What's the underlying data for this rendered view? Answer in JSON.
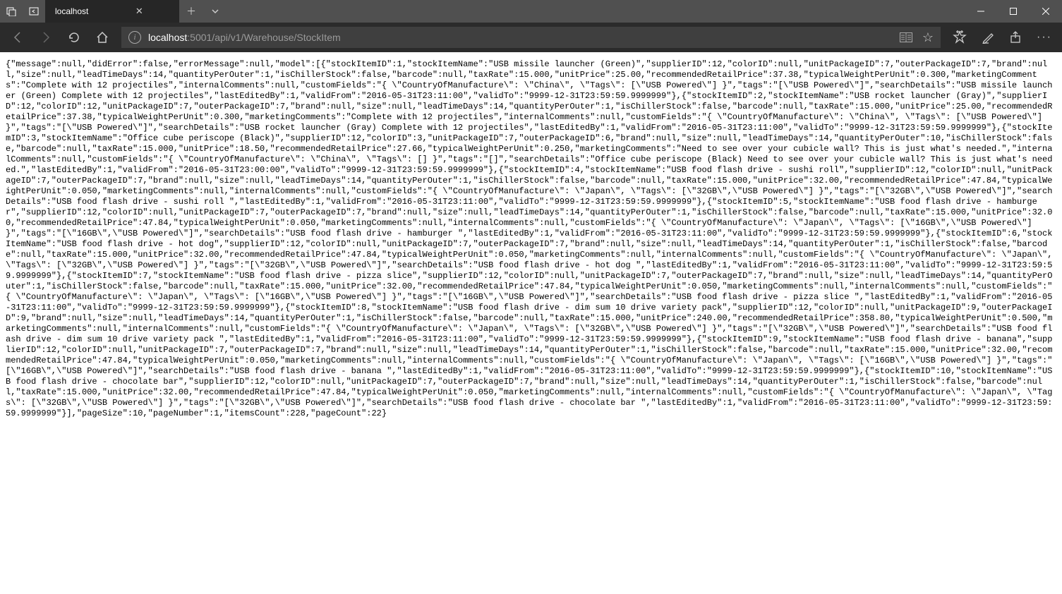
{
  "titlebar": {
    "tab_title": "localhost"
  },
  "address": {
    "host": "localhost",
    "path": ":5001/api/v1/Warehouse/StockItem"
  },
  "response_body": "{\"message\":null,\"didError\":false,\"errorMessage\":null,\"model\":[{\"stockItemID\":1,\"stockItemName\":\"USB missile launcher (Green)\",\"supplierID\":12,\"colorID\":null,\"unitPackageID\":7,\"outerPackageID\":7,\"brand\":null,\"size\":null,\"leadTimeDays\":14,\"quantityPerOuter\":1,\"isChillerStock\":false,\"barcode\":null,\"taxRate\":15.000,\"unitPrice\":25.00,\"recommendedRetailPrice\":37.38,\"typicalWeightPerUnit\":0.300,\"marketingComments\":\"Complete with 12 projectiles\",\"internalComments\":null,\"customFields\":\"{ \\\"CountryOfManufacture\\\": \\\"China\\\", \\\"Tags\\\": [\\\"USB Powered\\\"] }\",\"tags\":\"[\\\"USB Powered\\\"]\",\"searchDetails\":\"USB missile launcher (Green) Complete with 12 projectiles\",\"lastEditedBy\":1,\"validFrom\":\"2016-05-31T23:11:00\",\"validTo\":\"9999-12-31T23:59:59.9999999\"},{\"stockItemID\":2,\"stockItemName\":\"USB rocket launcher (Gray)\",\"supplierID\":12,\"colorID\":12,\"unitPackageID\":7,\"outerPackageID\":7,\"brand\":null,\"size\":null,\"leadTimeDays\":14,\"quantityPerOuter\":1,\"isChillerStock\":false,\"barcode\":null,\"taxRate\":15.000,\"unitPrice\":25.00,\"recommendedRetailPrice\":37.38,\"typicalWeightPerUnit\":0.300,\"marketingComments\":\"Complete with 12 projectiles\",\"internalComments\":null,\"customFields\":\"{ \\\"CountryOfManufacture\\\": \\\"China\\\", \\\"Tags\\\": [\\\"USB Powered\\\"] }\",\"tags\":\"[\\\"USB Powered\\\"]\",\"searchDetails\":\"USB rocket launcher (Gray) Complete with 12 projectiles\",\"lastEditedBy\":1,\"validFrom\":\"2016-05-31T23:11:00\",\"validTo\":\"9999-12-31T23:59:59.9999999\"},{\"stockItemID\":3,\"stockItemName\":\"Office cube periscope (Black)\",\"supplierID\":12,\"colorID\":3,\"unitPackageID\":7,\"outerPackageID\":6,\"brand\":null,\"size\":null,\"leadTimeDays\":14,\"quantityPerOuter\":10,\"isChillerStock\":false,\"barcode\":null,\"taxRate\":15.000,\"unitPrice\":18.50,\"recommendedRetailPrice\":27.66,\"typicalWeightPerUnit\":0.250,\"marketingComments\":\"Need to see over your cubicle wall? This is just what's needed.\",\"internalComments\":null,\"customFields\":\"{ \\\"CountryOfManufacture\\\": \\\"China\\\", \\\"Tags\\\": [] }\",\"tags\":\"[]\",\"searchDetails\":\"Office cube periscope (Black) Need to see over your cubicle wall? This is just what's needed.\",\"lastEditedBy\":1,\"validFrom\":\"2016-05-31T23:00:00\",\"validTo\":\"9999-12-31T23:59:59.9999999\"},{\"stockItemID\":4,\"stockItemName\":\"USB food flash drive - sushi roll\",\"supplierID\":12,\"colorID\":null,\"unitPackageID\":7,\"outerPackageID\":7,\"brand\":null,\"size\":null,\"leadTimeDays\":14,\"quantityPerOuter\":1,\"isChillerStock\":false,\"barcode\":null,\"taxRate\":15.000,\"unitPrice\":32.00,\"recommendedRetailPrice\":47.84,\"typicalWeightPerUnit\":0.050,\"marketingComments\":null,\"internalComments\":null,\"customFields\":\"{ \\\"CountryOfManufacture\\\": \\\"Japan\\\", \\\"Tags\\\": [\\\"32GB\\\",\\\"USB Powered\\\"] }\",\"tags\":\"[\\\"32GB\\\",\\\"USB Powered\\\"]\",\"searchDetails\":\"USB food flash drive - sushi roll \",\"lastEditedBy\":1,\"validFrom\":\"2016-05-31T23:11:00\",\"validTo\":\"9999-12-31T23:59:59.9999999\"},{\"stockItemID\":5,\"stockItemName\":\"USB food flash drive - hamburger\",\"supplierID\":12,\"colorID\":null,\"unitPackageID\":7,\"outerPackageID\":7,\"brand\":null,\"size\":null,\"leadTimeDays\":14,\"quantityPerOuter\":1,\"isChillerStock\":false,\"barcode\":null,\"taxRate\":15.000,\"unitPrice\":32.00,\"recommendedRetailPrice\":47.84,\"typicalWeightPerUnit\":0.050,\"marketingComments\":null,\"internalComments\":null,\"customFields\":\"{ \\\"CountryOfManufacture\\\": \\\"Japan\\\", \\\"Tags\\\": [\\\"16GB\\\",\\\"USB Powered\\\"] }\",\"tags\":\"[\\\"16GB\\\",\\\"USB Powered\\\"]\",\"searchDetails\":\"USB food flash drive - hamburger \",\"lastEditedBy\":1,\"validFrom\":\"2016-05-31T23:11:00\",\"validTo\":\"9999-12-31T23:59:59.9999999\"},{\"stockItemID\":6,\"stockItemName\":\"USB food flash drive - hot dog\",\"supplierID\":12,\"colorID\":null,\"unitPackageID\":7,\"outerPackageID\":7,\"brand\":null,\"size\":null,\"leadTimeDays\":14,\"quantityPerOuter\":1,\"isChillerStock\":false,\"barcode\":null,\"taxRate\":15.000,\"unitPrice\":32.00,\"recommendedRetailPrice\":47.84,\"typicalWeightPerUnit\":0.050,\"marketingComments\":null,\"internalComments\":null,\"customFields\":\"{ \\\"CountryOfManufacture\\\": \\\"Japan\\\", \\\"Tags\\\": [\\\"32GB\\\",\\\"USB Powered\\\"] }\",\"tags\":\"[\\\"32GB\\\",\\\"USB Powered\\\"]\",\"searchDetails\":\"USB food flash drive - hot dog \",\"lastEditedBy\":1,\"validFrom\":\"2016-05-31T23:11:00\",\"validTo\":\"9999-12-31T23:59:59.9999999\"},{\"stockItemID\":7,\"stockItemName\":\"USB food flash drive - pizza slice\",\"supplierID\":12,\"colorID\":null,\"unitPackageID\":7,\"outerPackageID\":7,\"brand\":null,\"size\":null,\"leadTimeDays\":14,\"quantityPerOuter\":1,\"isChillerStock\":false,\"barcode\":null,\"taxRate\":15.000,\"unitPrice\":32.00,\"recommendedRetailPrice\":47.84,\"typicalWeightPerUnit\":0.050,\"marketingComments\":null,\"internalComments\":null,\"customFields\":\"{ \\\"CountryOfManufacture\\\": \\\"Japan\\\", \\\"Tags\\\": [\\\"16GB\\\",\\\"USB Powered\\\"] }\",\"tags\":\"[\\\"16GB\\\",\\\"USB Powered\\\"]\",\"searchDetails\":\"USB food flash drive - pizza slice \",\"lastEditedBy\":1,\"validFrom\":\"2016-05-31T23:11:00\",\"validTo\":\"9999-12-31T23:59:59.9999999\"},{\"stockItemID\":8,\"stockItemName\":\"USB food flash drive - dim sum 10 drive variety pack\",\"supplierID\":12,\"colorID\":null,\"unitPackageID\":9,\"outerPackageID\":9,\"brand\":null,\"size\":null,\"leadTimeDays\":14,\"quantityPerOuter\":1,\"isChillerStock\":false,\"barcode\":null,\"taxRate\":15.000,\"unitPrice\":240.00,\"recommendedRetailPrice\":358.80,\"typicalWeightPerUnit\":0.500,\"marketingComments\":null,\"internalComments\":null,\"customFields\":\"{ \\\"CountryOfManufacture\\\": \\\"Japan\\\", \\\"Tags\\\": [\\\"32GB\\\",\\\"USB Powered\\\"] }\",\"tags\":\"[\\\"32GB\\\",\\\"USB Powered\\\"]\",\"searchDetails\":\"USB food flash drive - dim sum 10 drive variety pack \",\"lastEditedBy\":1,\"validFrom\":\"2016-05-31T23:11:00\",\"validTo\":\"9999-12-31T23:59:59.9999999\"},{\"stockItemID\":9,\"stockItemName\":\"USB food flash drive - banana\",\"supplierID\":12,\"colorID\":null,\"unitPackageID\":7,\"outerPackageID\":7,\"brand\":null,\"size\":null,\"leadTimeDays\":14,\"quantityPerOuter\":1,\"isChillerStock\":false,\"barcode\":null,\"taxRate\":15.000,\"unitPrice\":32.00,\"recommendedRetailPrice\":47.84,\"typicalWeightPerUnit\":0.050,\"marketingComments\":null,\"internalComments\":null,\"customFields\":\"{ \\\"CountryOfManufacture\\\": \\\"Japan\\\", \\\"Tags\\\": [\\\"16GB\\\",\\\"USB Powered\\\"] }\",\"tags\":\"[\\\"16GB\\\",\\\"USB Powered\\\"]\",\"searchDetails\":\"USB food flash drive - banana \",\"lastEditedBy\":1,\"validFrom\":\"2016-05-31T23:11:00\",\"validTo\":\"9999-12-31T23:59:59.9999999\"},{\"stockItemID\":10,\"stockItemName\":\"USB food flash drive - chocolate bar\",\"supplierID\":12,\"colorID\":null,\"unitPackageID\":7,\"outerPackageID\":7,\"brand\":null,\"size\":null,\"leadTimeDays\":14,\"quantityPerOuter\":1,\"isChillerStock\":false,\"barcode\":null,\"taxRate\":15.000,\"unitPrice\":32.00,\"recommendedRetailPrice\":47.84,\"typicalWeightPerUnit\":0.050,\"marketingComments\":null,\"internalComments\":null,\"customFields\":\"{ \\\"CountryOfManufacture\\\": \\\"Japan\\\", \\\"Tags\\\": [\\\"32GB\\\",\\\"USB Powered\\\"] }\",\"tags\":\"[\\\"32GB\\\",\\\"USB Powered\\\"]\",\"searchDetails\":\"USB food flash drive - chocolate bar \",\"lastEditedBy\":1,\"validFrom\":\"2016-05-31T23:11:00\",\"validTo\":\"9999-12-31T23:59:59.9999999\"}],\"pageSize\":10,\"pageNumber\":1,\"itemsCount\":228,\"pageCount\":22}"
}
